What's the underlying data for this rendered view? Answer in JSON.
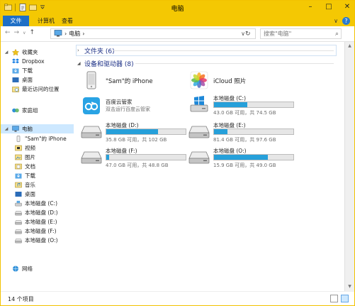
{
  "window": {
    "title": "电脑",
    "controls": {
      "minimize": "–",
      "maximize": "□",
      "close": "✕"
    }
  },
  "ribbon": {
    "tabs": [
      {
        "label": "文件"
      },
      {
        "label": "计算机"
      },
      {
        "label": "查看"
      }
    ],
    "expand": "∨",
    "help": "?"
  },
  "address": {
    "location_icon": "computer-icon",
    "separator": "›",
    "crumb": "电脑",
    "search_placeholder": "搜索\"电脑\""
  },
  "nav": {
    "favorites": {
      "label": "收藏夹",
      "items": [
        "Dropbox",
        "下载",
        "桌面",
        "最近访问的位置"
      ]
    },
    "homegroup": {
      "label": "家庭组"
    },
    "computer": {
      "label": "电脑",
      "items": [
        "\"Sam\"的 iPhone",
        "视频",
        "图片",
        "文档",
        "下载",
        "音乐",
        "桌面",
        "本地磁盘 (C:)",
        "本地磁盘 (D:)",
        "本地磁盘 (E:)",
        "本地磁盘 (F:)",
        "本地磁盘 (O:)"
      ]
    },
    "network": {
      "label": "网络"
    }
  },
  "content": {
    "folders_group": "文件夹 (6)",
    "devices_group": "设备和驱动器 (8)",
    "devices": [
      {
        "name": "\"Sam\"的 iPhone",
        "icon": "iphone-icon"
      },
      {
        "name": "iCloud 照片",
        "icon": "photos-icon"
      },
      {
        "name": "百度云管家",
        "sub": "双击运行百度云管家",
        "icon": "baidu-cloud-icon"
      }
    ],
    "drives": [
      {
        "name": "本地磁盘 (C:)",
        "space": "43.0 GB 可用，共 74.5 GB",
        "used_fraction": 0.42,
        "system": true
      },
      {
        "name": "本地磁盘 (D:)",
        "space": "35.8 GB 可用，共 102 GB",
        "used_fraction": 0.65
      },
      {
        "name": "本地磁盘 (E:)",
        "space": "81.4 GB 可用，共 97.6 GB",
        "used_fraction": 0.17
      },
      {
        "name": "本地磁盘 (F:)",
        "space": "47.0 GB 可用，共 48.8 GB",
        "used_fraction": 0.04
      },
      {
        "name": "本地磁盘 (O:)",
        "space": "15.9 GB 可用，共 49.0 GB",
        "used_fraction": 0.68
      }
    ]
  },
  "status": {
    "count": "14 个项目"
  }
}
